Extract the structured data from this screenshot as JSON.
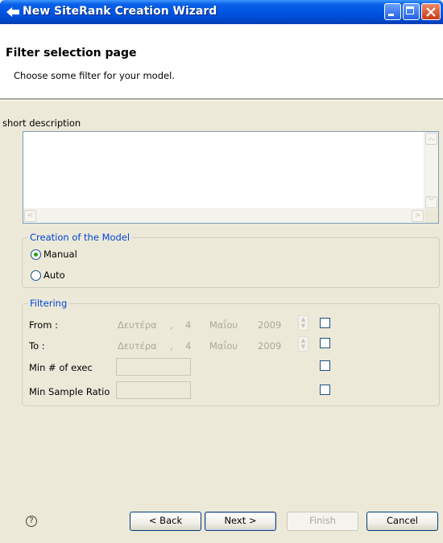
{
  "window": {
    "title": "New SiteRank Creation Wizard"
  },
  "header": {
    "title": "Filter selection page",
    "subtitle": "Choose some filter for your model."
  },
  "description": {
    "label": "short description",
    "value": ""
  },
  "creation": {
    "legend": "Creation of the Model",
    "options": [
      {
        "label": "Manual",
        "selected": true
      },
      {
        "label": "Auto",
        "selected": false
      }
    ]
  },
  "filtering": {
    "legend": "Filtering",
    "from": {
      "label": "From :",
      "day_name": "Δευτέρα",
      "day": "4",
      "month": "Μαΐου",
      "year": "2009"
    },
    "to": {
      "label": "To :",
      "day_name": "Δευτέρα",
      "day": "4",
      "month": "Μαΐου",
      "year": "2009"
    },
    "min_exec": {
      "label": "Min # of exec",
      "value": ""
    },
    "min_sample": {
      "label": "Min Sample Ratio",
      "value": ""
    }
  },
  "buttons": {
    "help": "?",
    "back": "< Back",
    "next": "Next >",
    "finish": "Finish",
    "cancel": "Cancel"
  },
  "colors": {
    "titlebar": "#0055e5",
    "legend": "#0046d5",
    "background": "#ece9d8"
  }
}
